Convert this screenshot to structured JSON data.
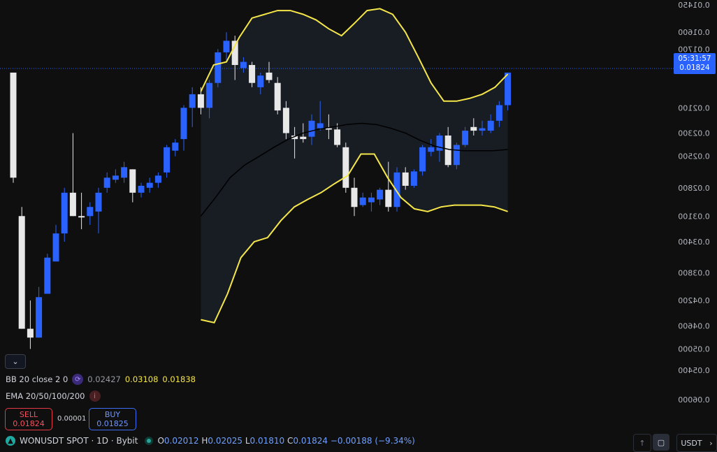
{
  "chart_data": {
    "type": "candlestick",
    "symbol": "WONUSDT SPOT · 1D · Bybit",
    "y_ticks": [
      "0.01450",
      "0.01600",
      "0.01700",
      "0.02100",
      "0.02300",
      "0.02500",
      "0.02800",
      "0.03100",
      "0.03400",
      "0.03800",
      "0.04200",
      "0.04600",
      "0.05000",
      "0.05400",
      "0.06000"
    ],
    "candles": [
      {
        "o": 0.0185,
        "h": 0.019,
        "l": 0.0275,
        "c": 0.027,
        "color": "white"
      },
      {
        "o": 0.031,
        "h": 0.03,
        "l": 0.0465,
        "c": 0.0465,
        "color": "white"
      },
      {
        "o": 0.0465,
        "h": 0.042,
        "l": 0.05,
        "c": 0.048,
        "color": "white"
      },
      {
        "o": 0.048,
        "h": 0.04,
        "l": 0.048,
        "c": 0.0415,
        "color": "blue"
      },
      {
        "o": 0.041,
        "h": 0.0355,
        "l": 0.041,
        "c": 0.036,
        "color": "blue"
      },
      {
        "o": 0.0365,
        "h": 0.032,
        "l": 0.0365,
        "c": 0.033,
        "color": "blue"
      },
      {
        "o": 0.033,
        "h": 0.028,
        "l": 0.034,
        "c": 0.0285,
        "color": "blue"
      },
      {
        "o": 0.0285,
        "h": 0.023,
        "l": 0.031,
        "c": 0.031,
        "color": "white"
      },
      {
        "o": 0.031,
        "h": 0.0285,
        "l": 0.0325,
        "c": 0.031,
        "color": "white"
      },
      {
        "o": 0.031,
        "h": 0.0295,
        "l": 0.032,
        "c": 0.03,
        "color": "blue"
      },
      {
        "o": 0.0305,
        "h": 0.028,
        "l": 0.033,
        "c": 0.0285,
        "color": "blue"
      },
      {
        "o": 0.028,
        "h": 0.0265,
        "l": 0.0285,
        "c": 0.027,
        "color": "blue"
      },
      {
        "o": 0.0272,
        "h": 0.0262,
        "l": 0.0275,
        "c": 0.0268,
        "color": "blue"
      },
      {
        "o": 0.027,
        "h": 0.0255,
        "l": 0.0275,
        "c": 0.026,
        "color": "blue"
      },
      {
        "o": 0.0262,
        "h": 0.0262,
        "l": 0.0295,
        "c": 0.0285,
        "color": "white"
      },
      {
        "o": 0.0285,
        "h": 0.0275,
        "l": 0.029,
        "c": 0.0278,
        "color": "blue"
      },
      {
        "o": 0.028,
        "h": 0.027,
        "l": 0.0285,
        "c": 0.0275,
        "color": "blue"
      },
      {
        "o": 0.0275,
        "h": 0.0265,
        "l": 0.028,
        "c": 0.0268,
        "color": "blue"
      },
      {
        "o": 0.0265,
        "h": 0.024,
        "l": 0.027,
        "c": 0.0242,
        "color": "blue"
      },
      {
        "o": 0.0245,
        "h": 0.0235,
        "l": 0.025,
        "c": 0.0238,
        "color": "blue"
      },
      {
        "o": 0.0235,
        "h": 0.0208,
        "l": 0.0245,
        "c": 0.021,
        "color": "blue"
      },
      {
        "o": 0.021,
        "h": 0.0195,
        "l": 0.0225,
        "c": 0.02,
        "color": "blue"
      },
      {
        "o": 0.02,
        "h": 0.0195,
        "l": 0.0215,
        "c": 0.021,
        "color": "white"
      },
      {
        "o": 0.021,
        "h": 0.019,
        "l": 0.0218,
        "c": 0.0192,
        "color": "blue"
      },
      {
        "o": 0.0192,
        "h": 0.017,
        "l": 0.0195,
        "c": 0.0172,
        "color": "blue"
      },
      {
        "o": 0.0172,
        "h": 0.016,
        "l": 0.0178,
        "c": 0.0165,
        "color": "blue"
      },
      {
        "o": 0.0165,
        "h": 0.0162,
        "l": 0.019,
        "c": 0.018,
        "color": "white"
      },
      {
        "o": 0.0182,
        "h": 0.0175,
        "l": 0.0185,
        "c": 0.0178,
        "color": "blue"
      },
      {
        "o": 0.018,
        "h": 0.0178,
        "l": 0.0195,
        "c": 0.0192,
        "color": "white"
      },
      {
        "o": 0.0195,
        "h": 0.0185,
        "l": 0.02,
        "c": 0.0187,
        "color": "blue"
      },
      {
        "o": 0.0185,
        "h": 0.0178,
        "l": 0.0192,
        "c": 0.019,
        "color": "white"
      },
      {
        "o": 0.0192,
        "h": 0.0188,
        "l": 0.0215,
        "c": 0.0212,
        "color": "white"
      },
      {
        "o": 0.021,
        "h": 0.0205,
        "l": 0.0235,
        "c": 0.023,
        "color": "white"
      },
      {
        "o": 0.0232,
        "h": 0.0225,
        "l": 0.0252,
        "c": 0.0235,
        "color": "white"
      },
      {
        "o": 0.0235,
        "h": 0.0222,
        "l": 0.0238,
        "c": 0.0233,
        "color": "white"
      },
      {
        "o": 0.0233,
        "h": 0.0215,
        "l": 0.024,
        "c": 0.022,
        "color": "blue"
      },
      {
        "o": 0.0222,
        "h": 0.0205,
        "l": 0.0228,
        "c": 0.0226,
        "color": "blue"
      },
      {
        "o": 0.0226,
        "h": 0.0215,
        "l": 0.0235,
        "c": 0.0227,
        "color": "white"
      },
      {
        "o": 0.0227,
        "h": 0.0222,
        "l": 0.0242,
        "c": 0.024,
        "color": "white"
      },
      {
        "o": 0.0242,
        "h": 0.0238,
        "l": 0.0285,
        "c": 0.028,
        "color": "white"
      },
      {
        "o": 0.028,
        "h": 0.027,
        "l": 0.031,
        "c": 0.03,
        "color": "white"
      },
      {
        "o": 0.0298,
        "h": 0.0285,
        "l": 0.03,
        "c": 0.029,
        "color": "blue"
      },
      {
        "o": 0.029,
        "h": 0.0285,
        "l": 0.0305,
        "c": 0.0295,
        "color": "blue"
      },
      {
        "o": 0.0292,
        "h": 0.028,
        "l": 0.0298,
        "c": 0.0282,
        "color": "blue"
      },
      {
        "o": 0.0282,
        "h": 0.0255,
        "l": 0.0305,
        "c": 0.03,
        "color": "white"
      },
      {
        "o": 0.03,
        "h": 0.026,
        "l": 0.0305,
        "c": 0.0265,
        "color": "blue"
      },
      {
        "o": 0.0265,
        "h": 0.026,
        "l": 0.0282,
        "c": 0.0278,
        "color": "white"
      },
      {
        "o": 0.0278,
        "h": 0.0262,
        "l": 0.028,
        "c": 0.0264,
        "color": "blue"
      },
      {
        "o": 0.0264,
        "h": 0.024,
        "l": 0.0268,
        "c": 0.0242,
        "color": "blue"
      },
      {
        "o": 0.0242,
        "h": 0.0235,
        "l": 0.025,
        "c": 0.0246,
        "color": "blue"
      },
      {
        "o": 0.0245,
        "h": 0.023,
        "l": 0.0255,
        "c": 0.0232,
        "color": "blue"
      },
      {
        "o": 0.0232,
        "h": 0.0225,
        "l": 0.026,
        "c": 0.0258,
        "color": "white"
      },
      {
        "o": 0.0258,
        "h": 0.0238,
        "l": 0.0262,
        "c": 0.024,
        "color": "blue"
      },
      {
        "o": 0.024,
        "h": 0.0225,
        "l": 0.0242,
        "c": 0.0228,
        "color": "blue"
      },
      {
        "o": 0.0228,
        "h": 0.0218,
        "l": 0.0232,
        "c": 0.0225,
        "color": "white"
      },
      {
        "o": 0.0226,
        "h": 0.022,
        "l": 0.0232,
        "c": 0.0228,
        "color": "blue"
      },
      {
        "o": 0.0228,
        "h": 0.0215,
        "l": 0.023,
        "c": 0.022,
        "color": "blue"
      },
      {
        "o": 0.022,
        "h": 0.0205,
        "l": 0.0225,
        "c": 0.0208,
        "color": "blue"
      },
      {
        "o": 0.0208,
        "h": 0.0185,
        "l": 0.0212,
        "c": 0.0185,
        "color": "blue"
      }
    ],
    "bb_upper": [
      0.0198,
      0.018,
      0.0178,
      0.0163,
      0.0152,
      0.015,
      0.0148,
      0.0148,
      0.015,
      0.0153,
      0.0158,
      0.0162,
      0.0155,
      0.0148,
      0.0147,
      0.015,
      0.016,
      0.0175,
      0.0192,
      0.0205,
      0.0205,
      0.0203,
      0.02,
      0.0195,
      0.0186
    ],
    "bb_lower": [
      0.045,
      0.0455,
      0.041,
      0.036,
      0.034,
      0.0335,
      0.0315,
      0.03,
      0.0292,
      0.0285,
      0.0276,
      0.0268,
      0.0248,
      0.0248,
      0.027,
      0.029,
      0.0302,
      0.0305,
      0.03,
      0.0298,
      0.0298,
      0.0298,
      0.03,
      0.0305
    ],
    "basis": [
      0.031,
      0.029,
      0.027,
      0.0258,
      0.025,
      0.0242,
      0.0235,
      0.023,
      0.0227,
      0.0225,
      0.0223,
      0.0222,
      0.0223,
      0.0226,
      0.023,
      0.0236,
      0.0241,
      0.0244,
      0.0245,
      0.0245,
      0.0245,
      0.0244
    ]
  },
  "price_tag": {
    "time": "05:31:57",
    "price": "0.01824"
  },
  "indicators": {
    "bb_label": "BB 20 close 2 0",
    "bb_mid": "0.02427",
    "bb_up": "0.03108",
    "bb_low": "0.01838",
    "ema_label": "EMA 20/50/100/200"
  },
  "trade": {
    "sell_label": "SELL",
    "sell_price": "0.01824",
    "spread": "0.00001",
    "buy_label": "BUY",
    "buy_price": "0.01825"
  },
  "symbol_line": {
    "symbol": "WONUSDT SPOT · 1D · Bybit",
    "o_label": "O",
    "o_val": "0.02012",
    "h_label": "H",
    "h_val": "0.02025",
    "l_label": "L",
    "l_val": "0.01810",
    "c_label": "C",
    "c_val": "0.01824",
    "change": "−0.00188 (−9.34%)"
  },
  "currency_button": "USDT",
  "colors": {
    "blue": "#2962ff",
    "white": "#e8e8e8",
    "band": "#f5e64a",
    "basis": "#000000",
    "bg": "#0f0f0f"
  }
}
